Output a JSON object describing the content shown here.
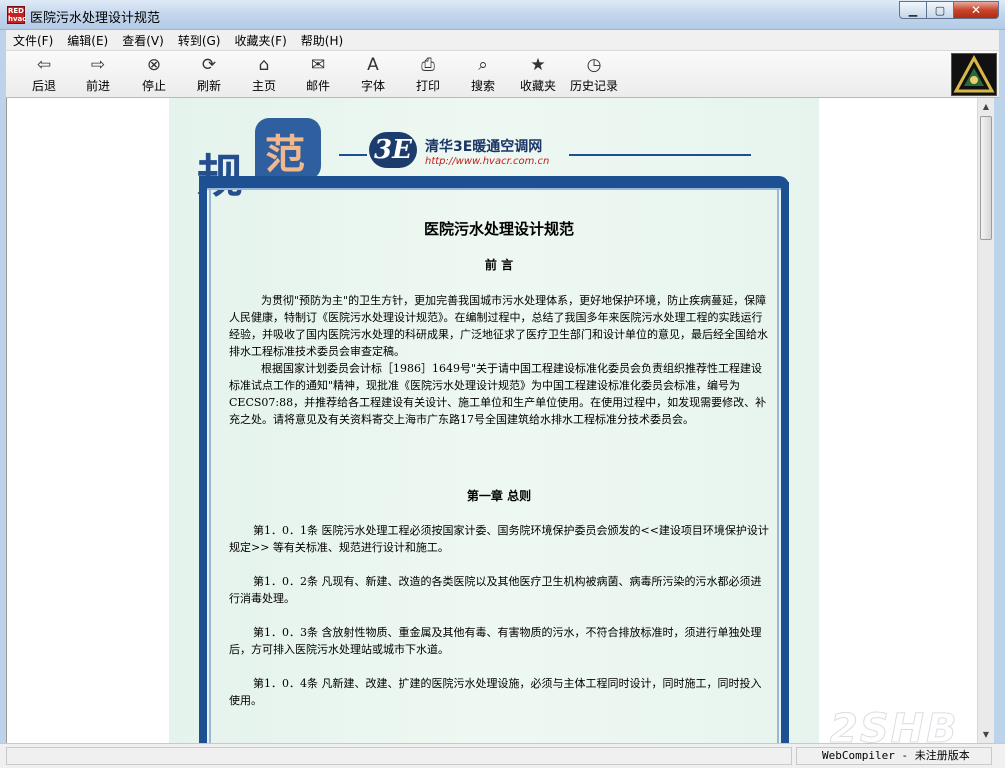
{
  "window": {
    "title": "医院污水处理设计规范",
    "controls": [
      "minimize",
      "maximize",
      "close"
    ]
  },
  "menu": [
    "文件(F)",
    "编辑(E)",
    "查看(V)",
    "转到(G)",
    "收藏夹(F)",
    "帮助(H)"
  ],
  "toolbar": [
    {
      "label": "后退",
      "icon": "back-arrow-icon",
      "glyph": "⇦"
    },
    {
      "label": "前进",
      "icon": "forward-arrow-icon",
      "glyph": "⇨"
    },
    {
      "label": "停止",
      "icon": "stop-icon",
      "glyph": "⊗"
    },
    {
      "label": "刷新",
      "icon": "refresh-icon",
      "glyph": "⟳"
    },
    {
      "label": "主页",
      "icon": "home-icon",
      "glyph": "⌂"
    },
    {
      "label": "邮件",
      "icon": "mail-icon",
      "glyph": "✉"
    },
    {
      "label": "字体",
      "icon": "font-icon",
      "glyph": "A"
    },
    {
      "label": "打印",
      "icon": "print-icon",
      "glyph": "⎙"
    },
    {
      "label": "搜索",
      "icon": "search-icon",
      "glyph": "⌕"
    },
    {
      "label": "收藏夹",
      "icon": "favorites-icon",
      "glyph": "★"
    },
    {
      "label": "历史记录",
      "icon": "history-icon",
      "glyph": "◷"
    }
  ],
  "header": {
    "gui_char": "规",
    "fan_char": "范",
    "logo_text": "3E",
    "site_name": "清华3E暖通空调网",
    "site_url": "http://www.hvacr.com.cn"
  },
  "document": {
    "title": "医院污水处理设计规范",
    "preface_heading": "前 言",
    "preface_paragraphs": [
      "为贯彻\"预防为主\"的卫生方针，更加完善我国城市污水处理体系，更好地保护环境，防止疾病蔓延，保障人民健康，特制订《医院污水处理设计规范》。在编制过程中，总结了我国多年来医院污水处理工程的实践运行经验，并吸收了国内医院污水处理的科研成果，广泛地征求了医疗卫生部门和设计单位的意见，最后经全国给水排水工程标准技术委员会审查定稿。",
      "根据国家计划委员会计标［1986］1649号\"关于请中国工程建设标准化委员会负责组织推荐性工程建设标准试点工作的通知\"精神，现批准《医院污水处理设计规范》为中国工程建设标准化委员会标准，编号为CECS07:88，并推荐给各工程建设有关设计、施工单位和生产单位使用。在使用过程中，如发现需要修改、补充之处。请将意见及有关资料寄交上海市广东路17号全国建筑给水排水工程标准分技术委员会。"
    ],
    "chapter_heading": "第一章 总则",
    "articles": [
      "第1．0．1条 医院污水处理工程必须按国家计委、国务院环境保护委员会颁发的<<建设项目环境保护设计规定>> 等有关标准、规范进行设计和施工。",
      "第1．0．2条 凡现有、新建、改造的各类医院以及其他医疗卫生机构被病菌、病毒所污染的污水都必须进行消毒处理。",
      "第1．0．3条 含放射性物质、重金属及其他有毒、有害物质的污水，不符合排放标准时，须进行单独处理后，方可排入医院污水处理站或城市下水道。",
      "第1．0．4条 凡新建、改建、扩建的医院污水处理设施，必须与主体工程同时设计，同时施工，同时投入使用。"
    ]
  },
  "status": {
    "left": "",
    "right": "WebCompiler - 未注册版本"
  },
  "watermark": "2SHB"
}
